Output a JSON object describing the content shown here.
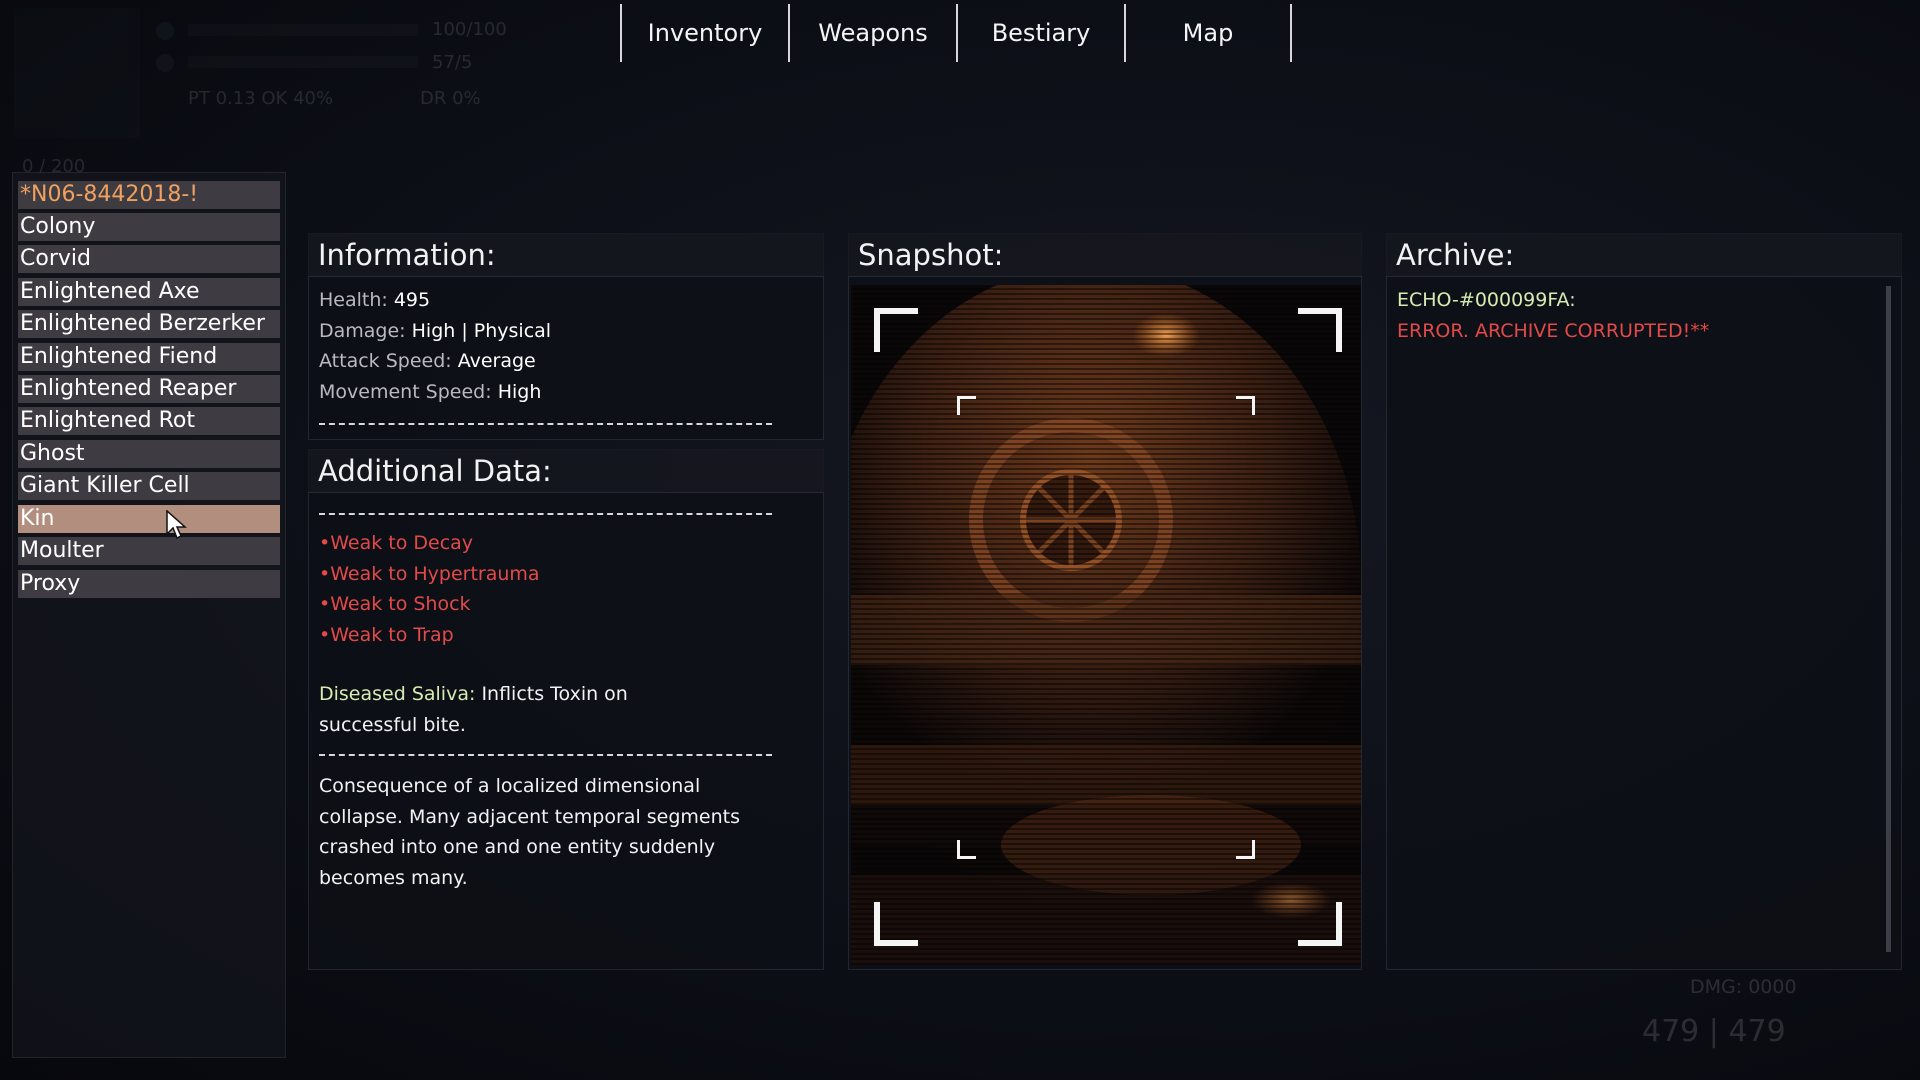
{
  "tabs": [
    {
      "label": "Inventory"
    },
    {
      "label": "Weapons"
    },
    {
      "label": "Bestiary"
    },
    {
      "label": "Map"
    }
  ],
  "hud": {
    "health": "100/100",
    "stamina": "57/5",
    "armor": "PT 0.13 OK 40%",
    "resist": "DR 0%",
    "ammo": "0 / 200"
  },
  "bottom_hud": {
    "damage": "DMG: 0000",
    "ammo": "479 | 479"
  },
  "bestiary_list": [
    {
      "name": "*N06-8442018-!"
    },
    {
      "name": "Colony"
    },
    {
      "name": "Corvid"
    },
    {
      "name": "Enlightened Axe"
    },
    {
      "name": "Enlightened Berzerker"
    },
    {
      "name": "Enlightened Fiend"
    },
    {
      "name": "Enlightened Reaper"
    },
    {
      "name": "Enlightened Rot"
    },
    {
      "name": "Ghost"
    },
    {
      "name": "Giant Killer Cell"
    },
    {
      "name": "Kin"
    },
    {
      "name": "Moulter"
    },
    {
      "name": "Proxy"
    }
  ],
  "selected_index": 10,
  "information": {
    "heading": "Information:",
    "health_label": "Health:",
    "health_value": "495",
    "damage_label": "Damage:",
    "damage_value": "High | Physical",
    "attack_speed_label": "Attack Speed:",
    "attack_speed_value": "Average",
    "movement_speed_label": "Movement Speed:",
    "movement_speed_value": "High"
  },
  "additional": {
    "heading": "Additional Data:",
    "weaknesses": [
      "•Weak to Decay",
      "•Weak to Hypertrauma",
      "•Weak to Shock",
      "•Weak to Trap"
    ],
    "ability_name": "Diseased Saliva:",
    "ability_text_1": "Inflicts Toxin on",
    "ability_text_2": "successful bite.",
    "description": [
      "Consequence of a localized dimensional",
      "collapse. Many adjacent temporal segments",
      "crashed into one and one entity suddenly",
      "becomes many."
    ]
  },
  "snapshot": {
    "heading": "Snapshot:"
  },
  "archive": {
    "heading": "Archive:",
    "id": "ECHO-#000099FA:",
    "error": "ERROR. ARCHIVE CORRUPTED!**"
  },
  "colors": {
    "accent_orange": "#f0a060",
    "selected_row": "#b28e7f",
    "weakness_red": "#e24a4a",
    "highlight_green": "#d6ecb2"
  },
  "icons": [
    "mouse-cursor-icon",
    "creature-snapshot-image"
  ]
}
